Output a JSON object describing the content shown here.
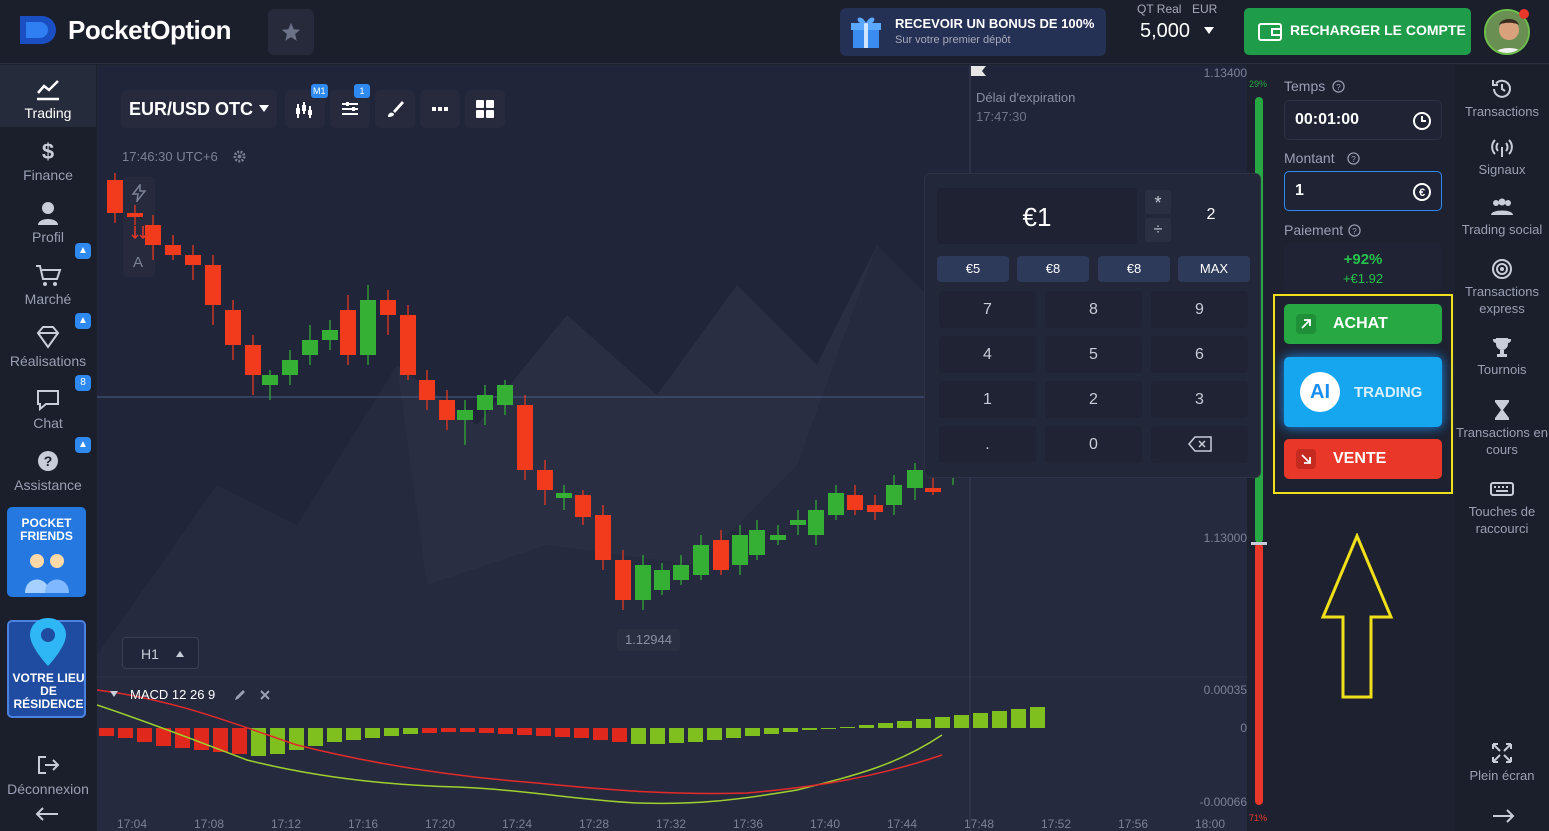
{
  "header": {
    "brand": "PocketOption",
    "bonus_title": "RECEVOIR UN BONUS DE 100%",
    "bonus_subtitle": "Sur votre premier dépôt",
    "account_type": "QT Real",
    "account_currency": "EUR",
    "balance": "5,000",
    "recharge_label": "RECHARGER LE COMPTE"
  },
  "sidebar": {
    "items": [
      {
        "label": "Trading",
        "icon": "chart-line-icon"
      },
      {
        "label": "Finance",
        "icon": "dollar-icon"
      },
      {
        "label": "Profil",
        "icon": "user-icon"
      },
      {
        "label": "Marché",
        "icon": "cart-icon"
      },
      {
        "label": "Réalisations",
        "icon": "diamond-icon"
      },
      {
        "label": "Chat",
        "icon": "chat-icon",
        "badge": "8"
      },
      {
        "label": "Assistance",
        "icon": "help-icon"
      }
    ],
    "promo1": "POCKET FRIENDS",
    "promo2": "VOTRE LIEU DE RÉSIDENCE",
    "logout": "Déconnexion"
  },
  "toolbar": {
    "pair": "EUR/USD OTC",
    "m1_badge": "M1",
    "settings_badge": "1",
    "timeframe": "H1",
    "clock": "17:46:30 UTC+6"
  },
  "chart": {
    "expiry_label": "Délai d'expiration",
    "expiry_time": "17:47:30",
    "price_top": "1.13400",
    "price_mid": "1.13000",
    "low_label": "1.12944",
    "pct_up": "29%",
    "pct_down": "71%",
    "macd_label": "MACD 12 26 9",
    "macd_top": "0.00035",
    "macd_zero": "0",
    "macd_bottom": "-0.00066",
    "times": [
      "17:04",
      "17:08",
      "17:12",
      "17:16",
      "17:20",
      "17:24",
      "17:28",
      "17:32",
      "17:36",
      "17:40",
      "17:44",
      "17:48",
      "17:52",
      "17:56",
      "18:00"
    ]
  },
  "keypad": {
    "amount": "€1",
    "multiplier": "2",
    "quick": [
      "€5",
      "€8",
      "€8",
      "MAX"
    ],
    "keys": [
      "7",
      "8",
      "9",
      "4",
      "5",
      "6",
      "1",
      "2",
      "3",
      ".",
      "0"
    ]
  },
  "trade": {
    "time_label": "Temps",
    "time_value": "00:01:00",
    "amount_label": "Montant",
    "amount_value": "1",
    "payout_label": "Paiement",
    "payout_pct": "+92%",
    "payout_value": "+€1.92",
    "buy_label": "ACHAT",
    "ai_label": "TRADING",
    "ai_badge": "AI",
    "sell_label": "VENTE"
  },
  "right_sidebar": {
    "items": [
      {
        "label": "Transactions"
      },
      {
        "label": "Signaux"
      },
      {
        "label": "Trading social"
      },
      {
        "label": "Transactions express"
      },
      {
        "label": "Tournois"
      },
      {
        "label": "Transactions en cours"
      },
      {
        "label": "Touches de raccourci"
      },
      {
        "label": "Plein écran"
      }
    ]
  },
  "colors": {
    "bg": "#1e2130",
    "buy": "#27a843",
    "sell": "#e9372a",
    "accent": "#2e8af0",
    "highlight": "#f0e01a"
  }
}
